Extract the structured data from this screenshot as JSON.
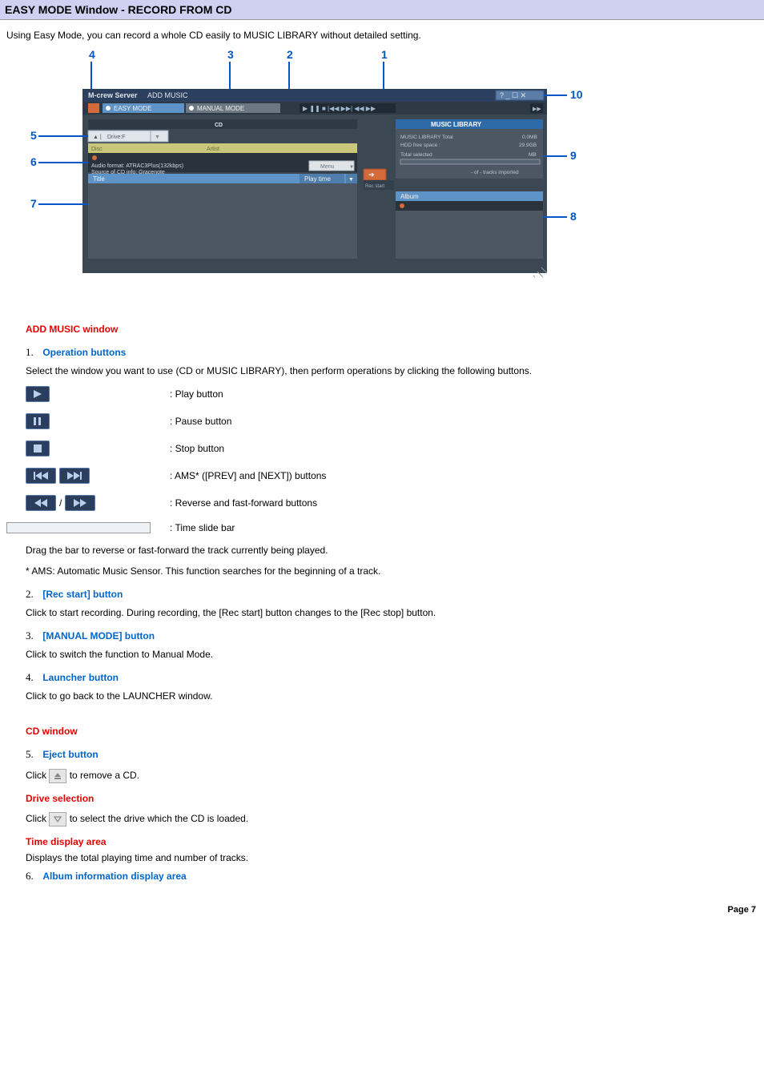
{
  "header": {
    "title": "EASY MODE Window - RECORD FROM CD"
  },
  "intro": "Using Easy Mode, you can record a whole CD easily to MUSIC LIBRARY without detailed setting.",
  "diagram": {
    "callouts": [
      "1",
      "2",
      "3",
      "4",
      "5",
      "6",
      "7",
      "8",
      "9",
      "10"
    ],
    "titlebar_app": "M-crew Server",
    "titlebar_sub": "ADD MUSIC",
    "tab_easy": "EASY MODE",
    "tab_manual": "MANUAL MODE",
    "cd_header": "CD",
    "drive_label": "Drive:F",
    "disc_label": "Disc",
    "artist_label": "Artist",
    "audio_format": "Audio format: ATRAC3Plus(132kbps)",
    "source_info": "Source of CD info: Gracenote",
    "menu_btn": "Menu",
    "title_col": "Title",
    "playtime_col": "Play time",
    "rec_start": "Rec start",
    "music_library_header": "MUSIC LIBRARY",
    "ml_total_label": "MUSIC LIBRARY Total",
    "ml_total_val": "0.0MB",
    "hdd_free_label": "HDD free space :",
    "hdd_free_val": "29.9GB",
    "total_selected_label": "Total selected",
    "total_selected_val": "MB",
    "tracks_imported": "- of - tracks imported",
    "album_label": "Album"
  },
  "sections": {
    "add_music_window": "ADD MUSIC window",
    "cd_window": "CD window"
  },
  "step1": {
    "title": "Operation buttons",
    "desc": "Select the window you want to use (CD or MUSIC LIBRARY), then perform operations by clicking the following buttons.",
    "buttons": {
      "play": ": Play button",
      "pause": ": Pause button",
      "stop": ": Stop button",
      "ams": ": AMS* ([PREV] and [NEXT]) buttons",
      "revff": ": Reverse and fast-forward buttons",
      "slash": "/"
    },
    "timeslide": ": Time slide bar",
    "drag_note": "Drag the bar to reverse or fast-forward the track currently being played.",
    "ams_note": "* AMS: Automatic Music Sensor. This function searches for the beginning of a track."
  },
  "step2": {
    "title": "[Rec start] button",
    "desc": "Click to start recording. During recording, the [Rec start] button changes to the [Rec stop] button."
  },
  "step3": {
    "title": "[MANUAL MODE] button",
    "desc": "Click to switch the function to Manual Mode."
  },
  "step4": {
    "title": "Launcher button",
    "desc": "Click to go back to the LAUNCHER window."
  },
  "step5": {
    "title": "Eject button",
    "desc_prefix": "Click ",
    "desc_suffix": "to remove a CD."
  },
  "drive_selection": {
    "title": "Drive selection",
    "desc_prefix": "Click ",
    "desc_suffix": "to select the drive which the CD is loaded."
  },
  "time_display": {
    "title": "Time display area",
    "desc": "Displays the total playing time and number of tracks."
  },
  "step6": {
    "title": "Album information display area"
  },
  "footer": {
    "page": "Page 7"
  }
}
